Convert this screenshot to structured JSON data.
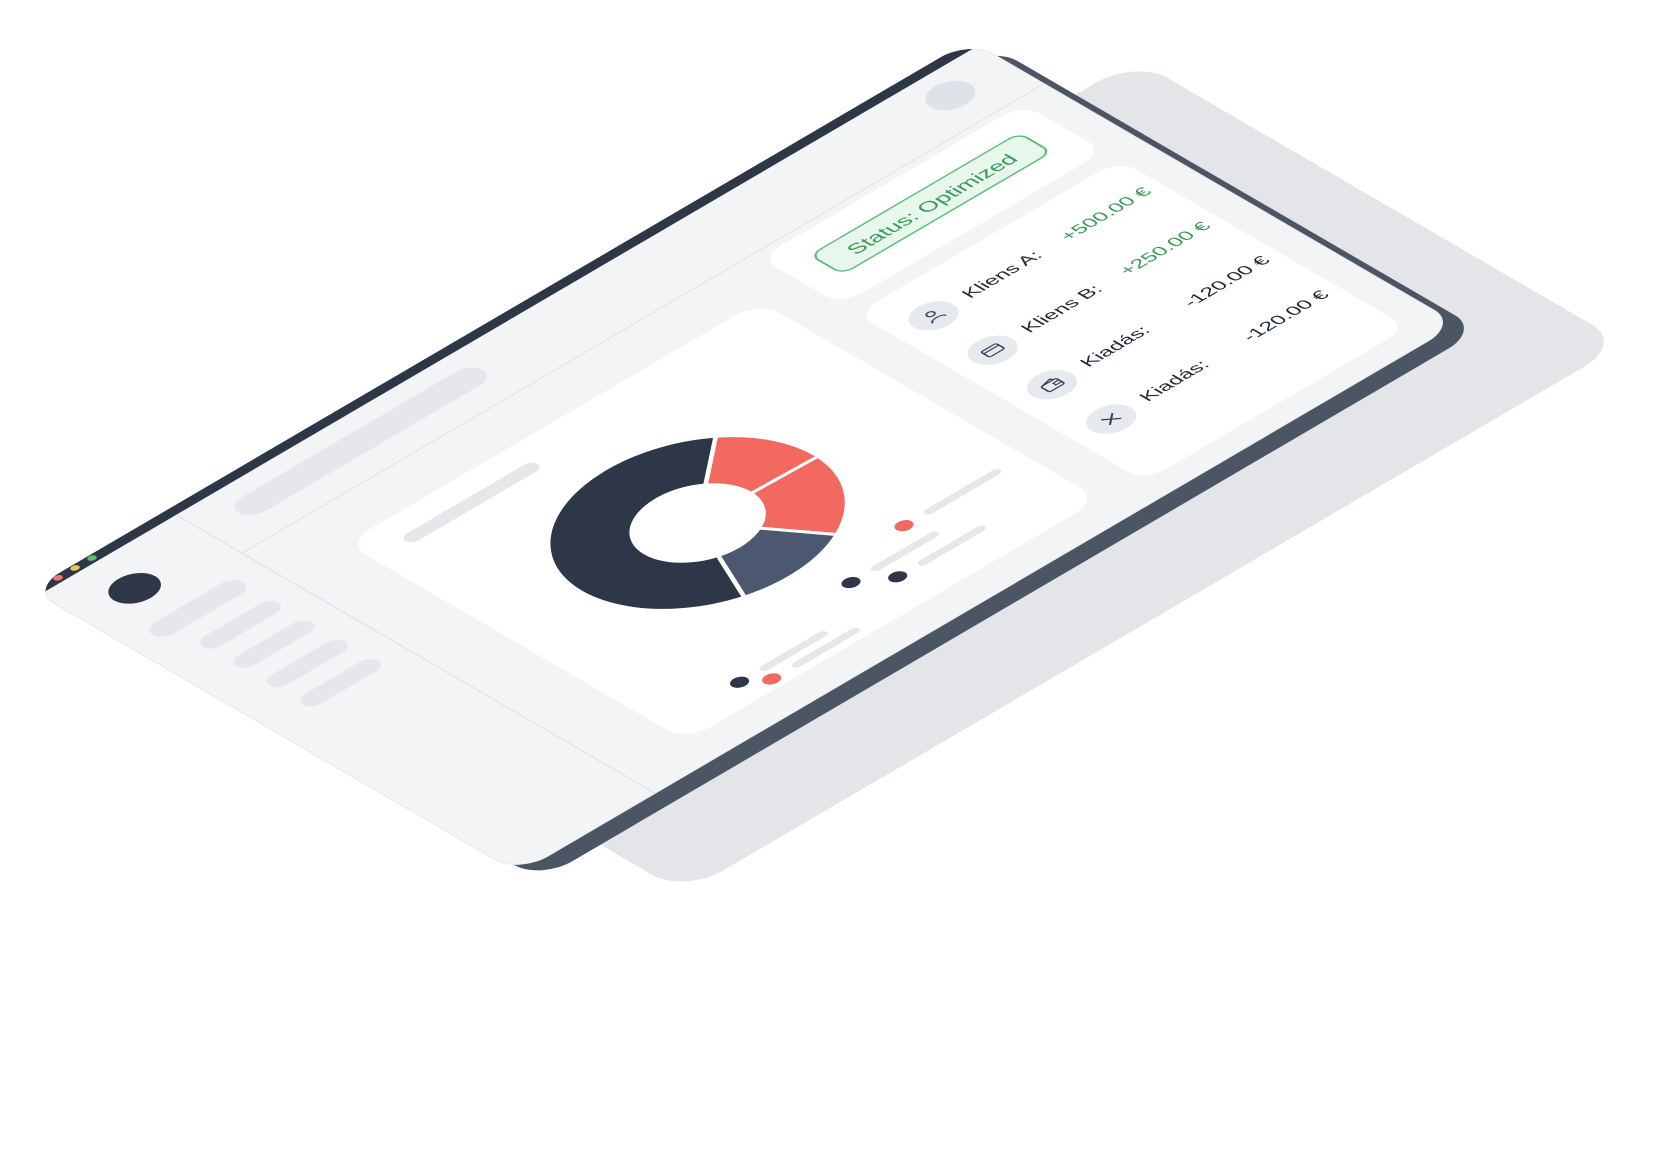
{
  "status": {
    "label": "Status: Optimized",
    "color": "#3a9a56"
  },
  "transactions": [
    {
      "icon": "user-icon",
      "label": "Kliens A:",
      "amount": "+500.00 €",
      "kind": "positive"
    },
    {
      "icon": "card-icon",
      "label": "Kliens B:",
      "amount": "+250.00 €",
      "kind": "positive"
    },
    {
      "icon": "wallet-icon",
      "label": "Kiadás:",
      "amount": "-120.00 €",
      "kind": "negative"
    },
    {
      "icon": "close-icon",
      "label": "Kiadás:",
      "amount": "-120.00 €",
      "kind": "negative"
    }
  ],
  "chart_data": {
    "type": "pie",
    "slices": [
      {
        "value": 57,
        "color": "#2d3748"
      },
      {
        "value": 13,
        "color": "#f1695f"
      },
      {
        "value": 16,
        "color": "#f1695f"
      },
      {
        "value": 14,
        "color": "#4b5870"
      }
    ],
    "legend_colors": [
      "#f1695f",
      "#2d3748",
      "#2d3748",
      "#2d3748",
      "#f1695f"
    ]
  },
  "colors": {
    "accent_positive": "#3a9a56",
    "accent_red": "#f1695f",
    "dark": "#2d3748",
    "window_bg": "#f3f4f6"
  }
}
